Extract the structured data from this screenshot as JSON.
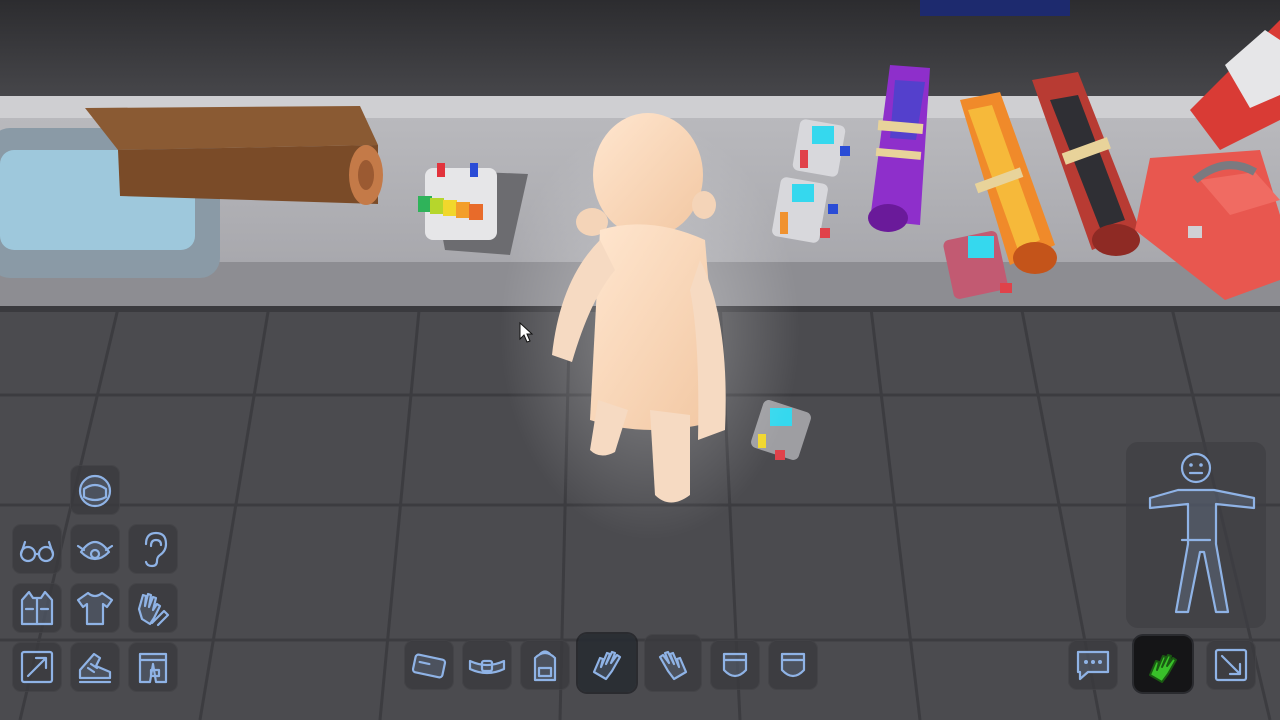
{
  "scene": {
    "type": "3d-game-dressing-room",
    "objects": [
      "table",
      "log",
      "monitor-device",
      "mannequin",
      "scroll-purple",
      "scroll-orange",
      "scroll-red",
      "battery-gadget",
      "toolbox"
    ]
  },
  "equipment_slots": {
    "left": [
      {
        "name": "helmet-icon"
      },
      {
        "name": "glasses-icon"
      },
      {
        "name": "mask-icon"
      },
      {
        "name": "ear-icon"
      },
      {
        "name": "vest-icon"
      },
      {
        "name": "shirt-icon"
      },
      {
        "name": "gloves-icon"
      },
      {
        "name": "expand-icon"
      },
      {
        "name": "shoes-icon"
      },
      {
        "name": "pants-icon"
      }
    ],
    "bottom": [
      {
        "name": "card-icon"
      },
      {
        "name": "belt-icon"
      },
      {
        "name": "backpack-icon"
      },
      {
        "name": "left-hand-icon",
        "active": true
      },
      {
        "name": "right-hand-icon"
      },
      {
        "name": "pocket-left-icon"
      },
      {
        "name": "pocket-right-icon"
      }
    ],
    "right": [
      {
        "name": "chat-icon"
      },
      {
        "name": "hand-gesture-icon"
      },
      {
        "name": "fullscreen-icon"
      }
    ]
  },
  "colors": {
    "icon_stroke": "#8fb3e6",
    "slot_bg": "#3a3a3e",
    "green_accent": "#39c12a"
  }
}
